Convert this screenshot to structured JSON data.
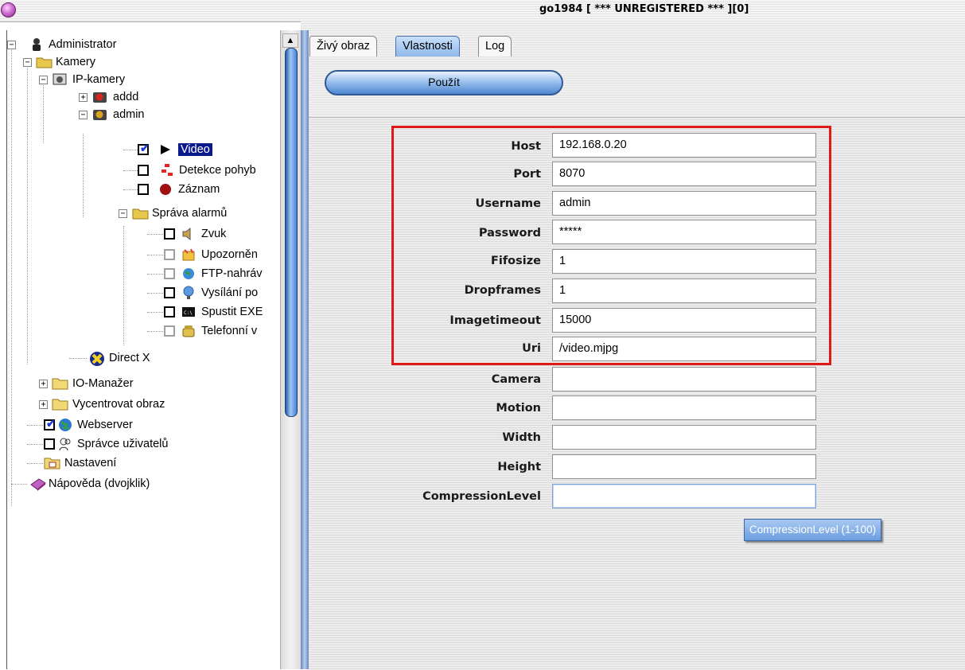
{
  "window": {
    "title": "go1984 [ *** UNREGISTERED *** ][0]"
  },
  "tree": {
    "root": "Administrator",
    "cameras": "Kamery",
    "ip_cameras": "IP-kamery",
    "camera_addd": "addd",
    "camera_admin": "admin",
    "video": "Video",
    "motion_detection": "Detekce pohyb",
    "recording": "Záznam",
    "alarm_management": "Správa alarmů",
    "sound": "Zvuk",
    "notification": "Upozorněn",
    "ftp_upload": "FTP-nahráv",
    "broadcast": "Vysílání po",
    "run_exe": "Spustit EXE",
    "phone": "Telefonní v",
    "direct_x": "Direct X",
    "io_manager": "IO-Manažer",
    "center_image": "Vycentrovat obraz",
    "webserver": "Webserver",
    "user_manager": "Správce uživatelů",
    "settings": "Nastavení",
    "help": "Nápověda (dvojklik)"
  },
  "tabs": [
    "Živý obraz",
    "Vlastnosti",
    "Log"
  ],
  "active_tab": "Vlastnosti",
  "apply_button": "Použít",
  "properties": [
    {
      "label": "Host",
      "value": "192.168.0.20"
    },
    {
      "label": "Port",
      "value": "8070"
    },
    {
      "label": "Username",
      "value": "admin"
    },
    {
      "label": "Password",
      "value": "*****"
    },
    {
      "label": "Fifosize",
      "value": "1"
    },
    {
      "label": "Dropframes",
      "value": "1"
    },
    {
      "label": "Imagetimeout",
      "value": "15000"
    },
    {
      "label": "Uri",
      "value": "/video.mjpg"
    },
    {
      "label": "Camera",
      "value": ""
    },
    {
      "label": "Motion",
      "value": ""
    },
    {
      "label": "Width",
      "value": ""
    },
    {
      "label": "Height",
      "value": ""
    },
    {
      "label": "CompressionLevel",
      "value": ""
    }
  ],
  "tooltip": "CompressionLevel (1-100)",
  "colors": {
    "highlight": "#e01818",
    "selection": "#0a1a8a",
    "accent": "#4f87d1"
  }
}
